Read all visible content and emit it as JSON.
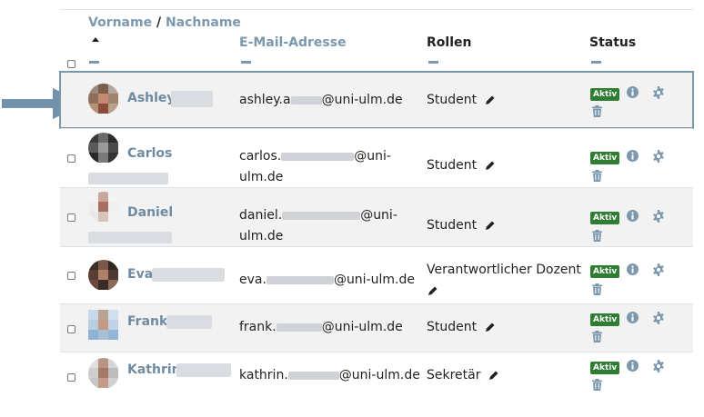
{
  "header": {
    "vorname": "Vorname",
    "separator": "/",
    "nachname": "Nachname",
    "email": "E-Mail-Adresse",
    "rollen": "Rollen",
    "status": "Status"
  },
  "rows": [
    {
      "first": "Ashley",
      "email_start": "ashley.a",
      "email_end": "@uni-ulm.de",
      "email_line2": "",
      "role": "Student",
      "status": "Aktiv"
    },
    {
      "first": "Carlos",
      "email_start": "carlos.",
      "email_end": "@uni-",
      "email_line2": "ulm.de",
      "role": "Student",
      "status": "Aktiv"
    },
    {
      "first": "Daniel",
      "email_start": "daniel.",
      "email_end": "@uni-",
      "email_line2": "ulm.de",
      "role": "Student",
      "status": "Aktiv"
    },
    {
      "first": "Eva",
      "email_start": "eva.",
      "email_end": "@uni-ulm.de",
      "email_line2": "",
      "role": "Verantwortlicher Dozent",
      "status": "Aktiv"
    },
    {
      "first": "Frank",
      "email_start": "frank.",
      "email_end": "@uni-ulm.de",
      "email_line2": "",
      "role": "Student",
      "status": "Aktiv"
    },
    {
      "first": "Kathrin",
      "email_start": "kathrin.",
      "email_end": "@uni-ulm.de",
      "email_line2": "",
      "role": "Sekretär",
      "status": "Aktiv"
    }
  ],
  "colors": {
    "accent": "#7c98ae",
    "badge": "#2f7d32",
    "highlight": "#7a97ab",
    "arrow": "#7192aa"
  },
  "icons": [
    "sort-up-icon",
    "pencil-icon",
    "info-icon",
    "gear-icon",
    "trash-icon",
    "pointer-arrow-icon"
  ]
}
